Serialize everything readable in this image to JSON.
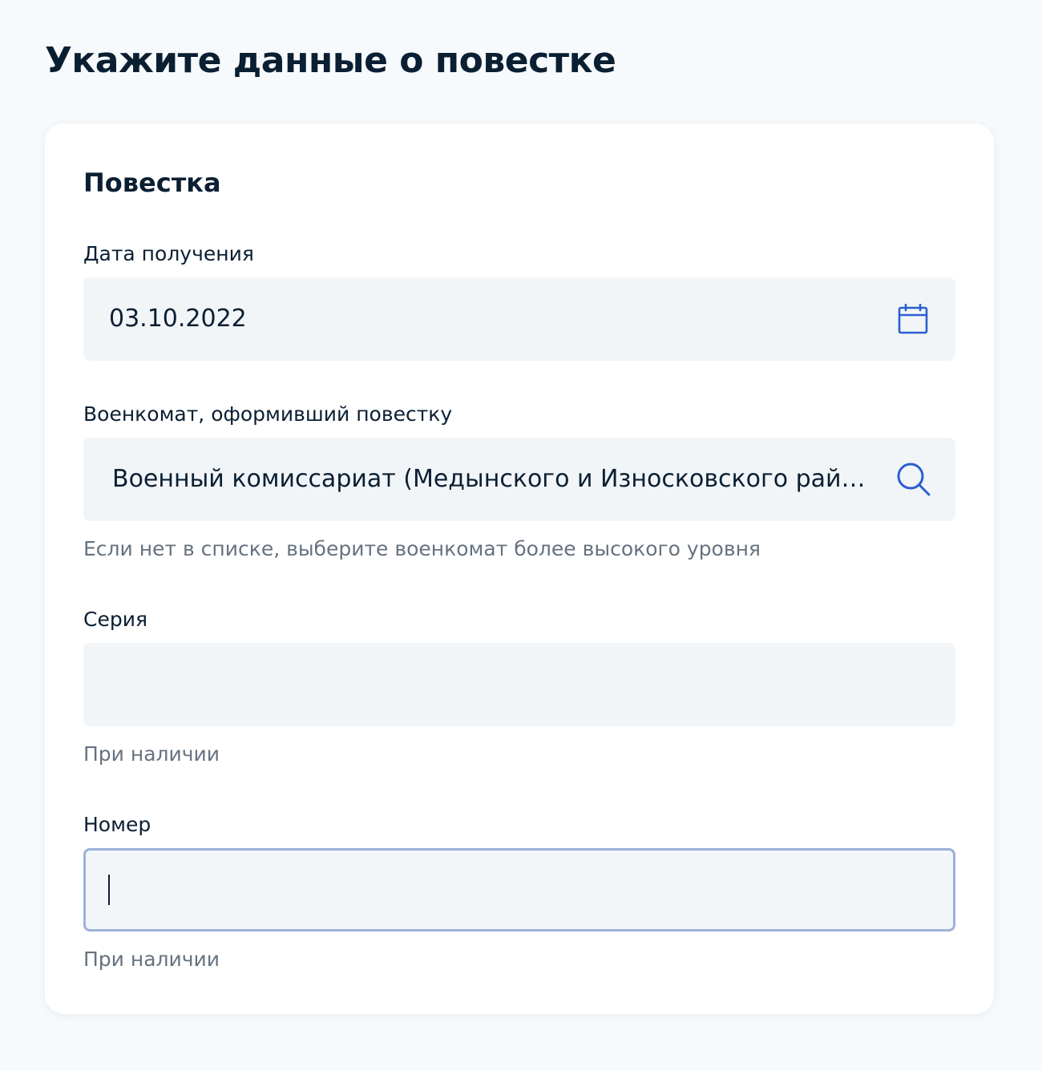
{
  "page": {
    "title": "Укажите данные о повестке"
  },
  "card": {
    "title": "Повестка",
    "fields": {
      "receipt_date": {
        "label": "Дата получения",
        "value": "03.10.2022",
        "icon": "calendar-icon"
      },
      "commissariat": {
        "label": "Военкомат, оформивший повестку",
        "value": "Военный комиссариат (Медынского и Износковского рай…",
        "icon": "search-icon",
        "hint": "Если нет в списке, выберите военкомат более высокого уровня"
      },
      "series": {
        "label": "Серия",
        "value": "",
        "hint": "При наличии"
      },
      "number": {
        "label": "Номер",
        "value": "",
        "hint": "При наличии"
      }
    }
  },
  "colors": {
    "text": "#0b1f33",
    "hint": "#66727f",
    "field_bg": "#f2f5f7",
    "focus_border": "#9db2d9",
    "icon_accent": "#2a5fd1",
    "page_bg": "#f7fafc"
  }
}
